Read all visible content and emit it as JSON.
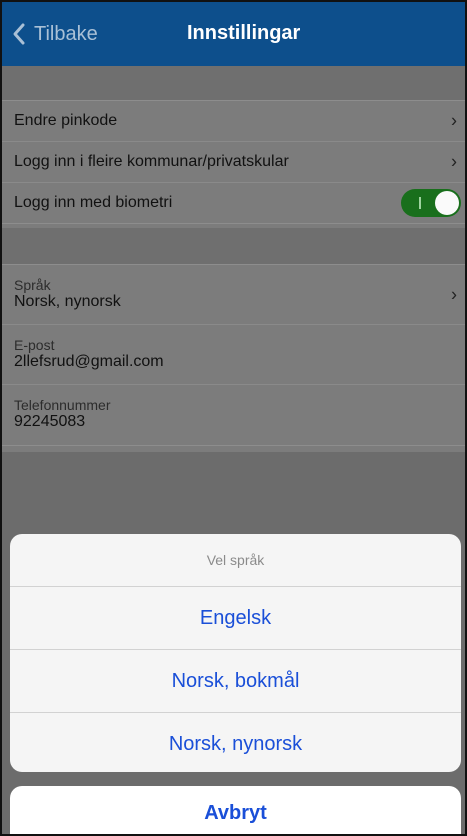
{
  "navbar": {
    "back_label": "Tilbake",
    "title": "Innstillingar"
  },
  "settings_group1": [
    {
      "label": "Endre pinkode"
    },
    {
      "label": "Logg inn i fleire kommunar/privatskular"
    },
    {
      "label": "Logg inn med biometri",
      "toggle_on": true
    }
  ],
  "settings_group2": [
    {
      "label": "Språk",
      "value": "Norsk, nynorsk"
    },
    {
      "label": "E-post",
      "value": "2llefsrud@gmail.com"
    },
    {
      "label": "Telefonnummer",
      "value": "92245083"
    }
  ],
  "sheet": {
    "title": "Vel språk",
    "options": [
      "Engelsk",
      "Norsk, bokmål",
      "Norsk, nynorsk"
    ],
    "cancel": "Avbryt"
  },
  "colors": {
    "navbar": "#0d4f8c",
    "accent_blue": "#1a4fd8",
    "toggle_green": "#196f1c"
  },
  "icons": {
    "back": "chevron-left-icon",
    "row": "chevron-right-icon"
  }
}
